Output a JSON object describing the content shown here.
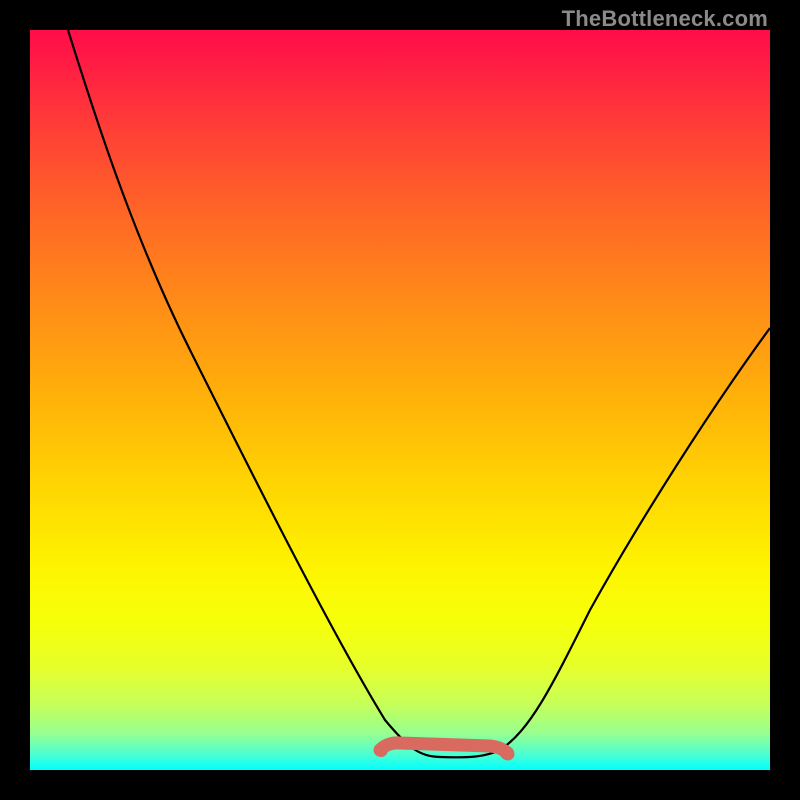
{
  "watermark": "TheBottleneck.com",
  "colors": {
    "page_bg": "#000000",
    "curve": "#000000",
    "flat_segment": "#d86a5f",
    "watermark": "#8a8a8a"
  },
  "chart_data": {
    "type": "line",
    "title": "",
    "xlabel": "",
    "ylabel": "",
    "xlim": [
      0,
      100
    ],
    "ylim": [
      0,
      100
    ],
    "grid": false,
    "legend": false,
    "annotations": [],
    "series": [
      {
        "name": "bottleneck-curve",
        "x": [
          0,
          6,
          12,
          18,
          24,
          30,
          36,
          42,
          47,
          51,
          55,
          58,
          61,
          65,
          70,
          76,
          82,
          88,
          94,
          100
        ],
        "values": [
          100,
          90,
          80,
          70,
          60,
          50,
          40,
          30,
          20,
          12,
          6,
          2,
          1,
          2,
          6,
          14,
          24,
          36,
          48,
          60
        ]
      }
    ],
    "flat_segment": {
      "x_start": 47,
      "x_end": 64,
      "y": 2.5
    },
    "background_gradient": {
      "stops": [
        {
          "pos": 0.0,
          "color": "#ff0d49"
        },
        {
          "pos": 0.13,
          "color": "#ff3d37"
        },
        {
          "pos": 0.25,
          "color": "#ff6726"
        },
        {
          "pos": 0.37,
          "color": "#ff8c17"
        },
        {
          "pos": 0.5,
          "color": "#ffb209"
        },
        {
          "pos": 0.62,
          "color": "#ffd602"
        },
        {
          "pos": 0.73,
          "color": "#fef500"
        },
        {
          "pos": 0.86,
          "color": "#e6ff2a"
        },
        {
          "pos": 0.95,
          "color": "#98ff8f"
        },
        {
          "pos": 1.0,
          "color": "#00ffff"
        }
      ]
    }
  }
}
